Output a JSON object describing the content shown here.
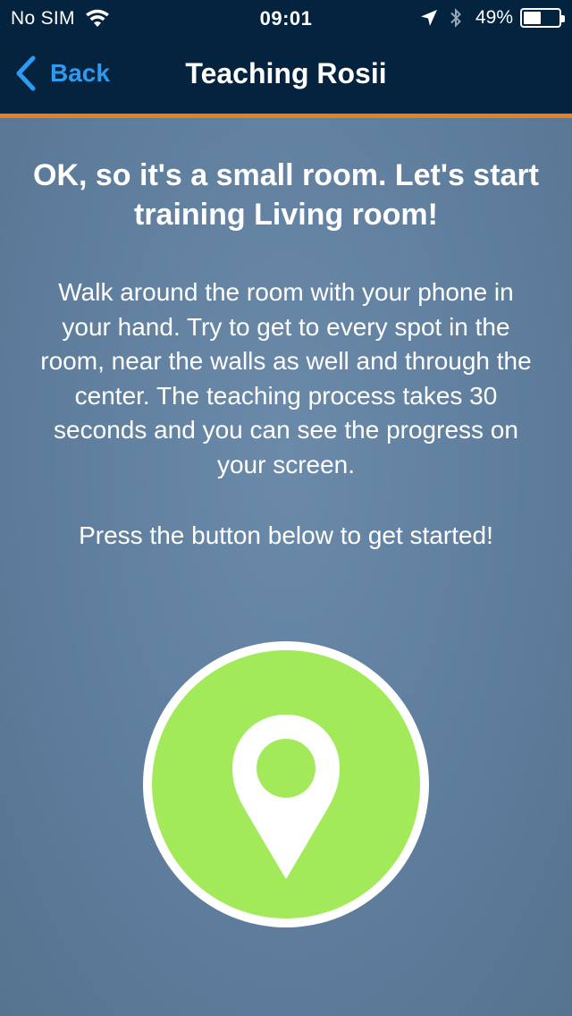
{
  "status_bar": {
    "carrier": "No SIM",
    "time": "09:01",
    "battery_percent": "49%",
    "battery_level": 0.49,
    "icons": [
      "wifi-icon",
      "location-arrow-icon",
      "bluetooth-icon",
      "battery-icon"
    ]
  },
  "nav": {
    "back_label": "Back",
    "title": "Teaching Rosii"
  },
  "content": {
    "headline": "OK, so it's a small room. Let's start training Living room!",
    "instructions": "Walk around the room with your phone in your hand. Try to get to every spot in the room, near the walls as well and through the center. The teaching process takes 30 seconds and you can see the progress on your screen.",
    "call_to_action": "Press the button below to get started!"
  },
  "start_button": {
    "icon": "map-pin-icon"
  },
  "colors": {
    "nav_background": "#03233f",
    "accent_line": "#e8801e",
    "back_blue": "#2f9bf0",
    "button_green": "#a2ea5a",
    "screen_background": "#5f7e9e"
  }
}
